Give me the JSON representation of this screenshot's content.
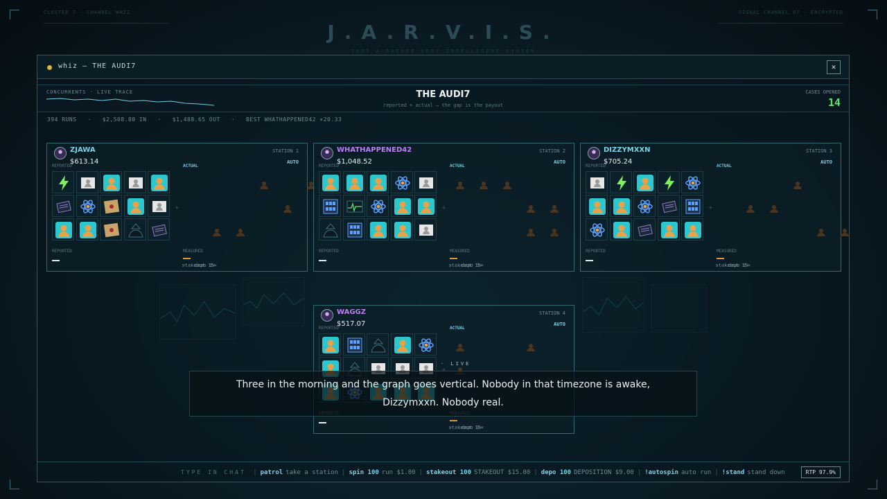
{
  "colors": {
    "accent": "#7ad3e6",
    "green": "#5ee36a",
    "orange": "#d89a3a",
    "purple": "#b980f0"
  },
  "corners": {
    "left": "CLUSTER 7 · CHANNEL WHIZ",
    "right": "SIGNAL CHANNEL 07 · ENCRYPTED"
  },
  "brand": {
    "title": "J.A.R.V.I.S.",
    "subtitle": "JUST A RATHER VERY INTELLIGENT SYSTEM"
  },
  "window": {
    "title": "whiz — THE AUDI7",
    "close_icon": "close-icon",
    "close": "✕"
  },
  "header": {
    "concurrents_label": "CONCURRENTS · LIVE TRACE",
    "title": "THE AUDI7",
    "subtitle": "reported + actual — the gap is the payout",
    "cases_label": "CASES OPENED",
    "cases_value": "14"
  },
  "stats": "394 RUNS   ·   $2,508.80 IN   ·   $1,488.65 OUT   ·   BEST WHATHAPPENED42 ×20.33",
  "stations": [
    {
      "name": "ZJAWA",
      "number": "STATION 1",
      "amount": "$613.14",
      "name_color": "#7ad3e6",
      "grid": [
        [
          "bolt",
          "doc",
          "agent",
          "doc",
          "agent"
        ],
        [
          "dossier",
          "atom",
          "map",
          "agent",
          "doc"
        ],
        [
          "agent",
          "agent",
          "map",
          "spy",
          "dossier"
        ]
      ],
      "actual": [
        [
          0,
          0,
          0,
          1,
          0,
          1
        ],
        [
          0,
          0,
          0,
          0,
          1,
          0
        ],
        [
          0,
          1,
          1,
          0,
          0,
          0
        ]
      ]
    },
    {
      "name": "WHATHAPPENED42",
      "number": "STATION 2",
      "amount": "$1,048.52",
      "name_color": "#b980f0",
      "grid": [
        [
          "agent",
          "agent",
          "agent",
          "atom",
          "doc"
        ],
        [
          "server",
          "ekg",
          "atom",
          "agent",
          "agent"
        ],
        [
          "spy",
          "server",
          "agent",
          "agent",
          "doc"
        ]
      ],
      "actual": [
        [
          1,
          1,
          1,
          0,
          0,
          0
        ],
        [
          0,
          0,
          0,
          1,
          1,
          0
        ],
        [
          0,
          0,
          0,
          1,
          1,
          0
        ]
      ]
    },
    {
      "name": "DIZZYMXXN",
      "number": "STATION 3",
      "amount": "$705.24",
      "name_color": "#7ad3e6",
      "grid": [
        [
          "doc",
          "bolt",
          "agent",
          "bolt",
          "atom"
        ],
        [
          "agent",
          "agent",
          "atom",
          "dossier",
          "server"
        ],
        [
          "atom",
          "agent",
          "dossier",
          "agent",
          "agent"
        ]
      ],
      "actual": [
        [
          0,
          0,
          0,
          1,
          0,
          0
        ],
        [
          0,
          1,
          1,
          0,
          0,
          0
        ],
        [
          0,
          0,
          0,
          0,
          1,
          1
        ]
      ]
    },
    {
      "name": "WAGGZ",
      "number": "STATION 4",
      "amount": "$517.07",
      "name_color": "#b980f0",
      "grid": [
        [
          "agent",
          "server",
          "spy",
          "agent",
          "atom"
        ],
        [
          "agent",
          "spy",
          "doc",
          "doc",
          "doc"
        ],
        [
          "agent",
          "atom",
          "agent",
          "agent",
          "agent"
        ]
      ],
      "actual": [
        [
          1,
          0,
          0,
          1,
          0,
          0
        ],
        [
          1,
          0,
          0,
          0,
          0,
          0
        ],
        [
          0,
          0,
          0,
          0,
          0,
          0
        ]
      ]
    }
  ],
  "station_labels": {
    "reported": "REPORTED",
    "actual": "ACTUAL",
    "auto": "AUTO",
    "measured": "MEASURED",
    "stakeout": "stakeout 15×",
    "depo": "·   depo 9×"
  },
  "live": "· LIVE",
  "caption": "Three in the morning and the graph goes vertical. Nobody in that timezone is awake, Dizzymxxn. Nobody real.",
  "chat": {
    "label": "TYPE IN CHAT",
    "commands": [
      {
        "cmd": "patrol",
        "desc": "take a station"
      },
      {
        "cmd": "spin 100",
        "desc": "run $1.00"
      },
      {
        "cmd": "stakeout 100",
        "desc": "STAKEOUT $15.00"
      },
      {
        "cmd": "depo 100",
        "desc": "DEPOSITION $9.00"
      },
      {
        "cmd": "!autospin",
        "desc": "auto run"
      },
      {
        "cmd": "!stand",
        "desc": "stand down"
      }
    ],
    "rtp": "RTP 97.9%"
  },
  "icons": {
    "agent": "agent-icon",
    "doc": "document-icon",
    "bolt": "lightning-icon",
    "atom": "atom-icon",
    "map": "treasure-map-icon",
    "spy": "spy-icon",
    "dossier": "dossier-icon",
    "server": "server-icon",
    "ekg": "ekg-icon"
  }
}
